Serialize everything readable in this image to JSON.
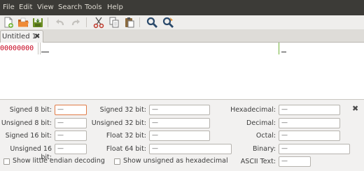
{
  "menubar": [
    "File",
    "Edit",
    "View",
    "Search",
    "Tools",
    "Help"
  ],
  "toolbar": {
    "buttons": [
      "new-document-icon",
      "open-folder-icon",
      "save-icon",
      "undo-icon",
      "redo-icon",
      "cut-icon",
      "copy-icon",
      "paste-icon",
      "find-icon",
      "find-replace-icon"
    ]
  },
  "tab": {
    "title": "Untitled 1",
    "close_glyph": "✖"
  },
  "hexview": {
    "offset": "00000000",
    "offset_color": "#c5001b"
  },
  "converter": {
    "col1": [
      {
        "label": "Signed 8 bit:",
        "value": "—"
      },
      {
        "label": "Unsigned 8 bit:",
        "value": "—"
      },
      {
        "label": "Signed 16 bit:",
        "value": "—"
      },
      {
        "label": "Unsigned 16 bit:",
        "value": "—"
      }
    ],
    "col2": [
      {
        "label": "Signed 32 bit:",
        "value": "—"
      },
      {
        "label": "Unsigned 32 bit:",
        "value": "—"
      },
      {
        "label": "Float 32 bit:",
        "value": "—"
      },
      {
        "label": "Float 64 bit:",
        "value": "—"
      }
    ],
    "col3": [
      {
        "label": "Hexadecimal:",
        "value": "—"
      },
      {
        "label": "Decimal:",
        "value": "—"
      },
      {
        "label": "Octal:",
        "value": "—"
      },
      {
        "label": "Binary:",
        "value": "—"
      },
      {
        "label": "ASCII Text:",
        "value": "—"
      }
    ],
    "little_endian_label": "Show little endian decoding",
    "unsigned_hex_label": "Show unsigned as hexadecimal",
    "close_glyph": "✖"
  }
}
